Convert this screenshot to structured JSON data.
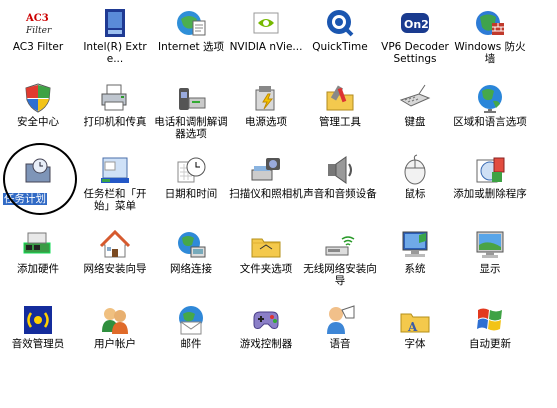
{
  "control_panel": {
    "items": [
      {
        "label": "AC3 Filter",
        "icon": "ac3-filter-icon"
      },
      {
        "label": "Intel(R) Extre...",
        "icon": "intel-graphics-icon"
      },
      {
        "label": "Internet 选项",
        "icon": "internet-options-icon"
      },
      {
        "label": "NVIDIA nVie...",
        "icon": "nvidia-icon"
      },
      {
        "label": "QuickTime",
        "icon": "quicktime-icon"
      },
      {
        "label": "VP6 Decoder Settings",
        "icon": "vp6-decoder-icon"
      },
      {
        "label": "Windows 防火墙",
        "icon": "firewall-icon"
      },
      {
        "label": "安全中心",
        "icon": "security-center-shield-icon"
      },
      {
        "label": "打印机和传真",
        "icon": "printer-icon"
      },
      {
        "label": "电话和调制解调器选项",
        "icon": "phone-modem-icon"
      },
      {
        "label": "电源选项",
        "icon": "power-options-icon"
      },
      {
        "label": "管理工具",
        "icon": "admin-tools-icon"
      },
      {
        "label": "键盘",
        "icon": "keyboard-icon"
      },
      {
        "label": "区域和语言选项",
        "icon": "globe-icon"
      },
      {
        "label": "任务计划",
        "icon": "scheduled-tasks-icon"
      },
      {
        "label": "任务栏和「开始」菜单",
        "icon": "taskbar-icon"
      },
      {
        "label": "日期和时间",
        "icon": "clock-icon"
      },
      {
        "label": "扫描仪和照相机",
        "icon": "scanner-camera-icon"
      },
      {
        "label": "声音和音频设备",
        "icon": "speaker-icon"
      },
      {
        "label": "鼠标",
        "icon": "mouse-icon"
      },
      {
        "label": "添加或删除程序",
        "icon": "add-remove-programs-icon"
      },
      {
        "label": "添加硬件",
        "icon": "add-hardware-icon"
      },
      {
        "label": "网络安装向导",
        "icon": "network-setup-house-icon"
      },
      {
        "label": "网络连接",
        "icon": "network-connections-icon"
      },
      {
        "label": "文件夹选项",
        "icon": "folder-options-icon"
      },
      {
        "label": "无线网络安装向导",
        "icon": "wireless-network-icon"
      },
      {
        "label": "系统",
        "icon": "system-computer-icon"
      },
      {
        "label": "显示",
        "icon": "display-monitor-icon"
      },
      {
        "label": "音效管理员",
        "icon": "sound-manager-icon"
      },
      {
        "label": "用户帐户",
        "icon": "user-accounts-icon"
      },
      {
        "label": "邮件",
        "icon": "mail-icon"
      },
      {
        "label": "游戏控制器",
        "icon": "game-controller-icon"
      },
      {
        "label": "语音",
        "icon": "speech-icon"
      },
      {
        "label": "字体",
        "icon": "fonts-folder-icon"
      },
      {
        "label": "自动更新",
        "icon": "windows-flag-icon"
      }
    ],
    "selected_index": 14,
    "selection_color": "#316ac5"
  }
}
